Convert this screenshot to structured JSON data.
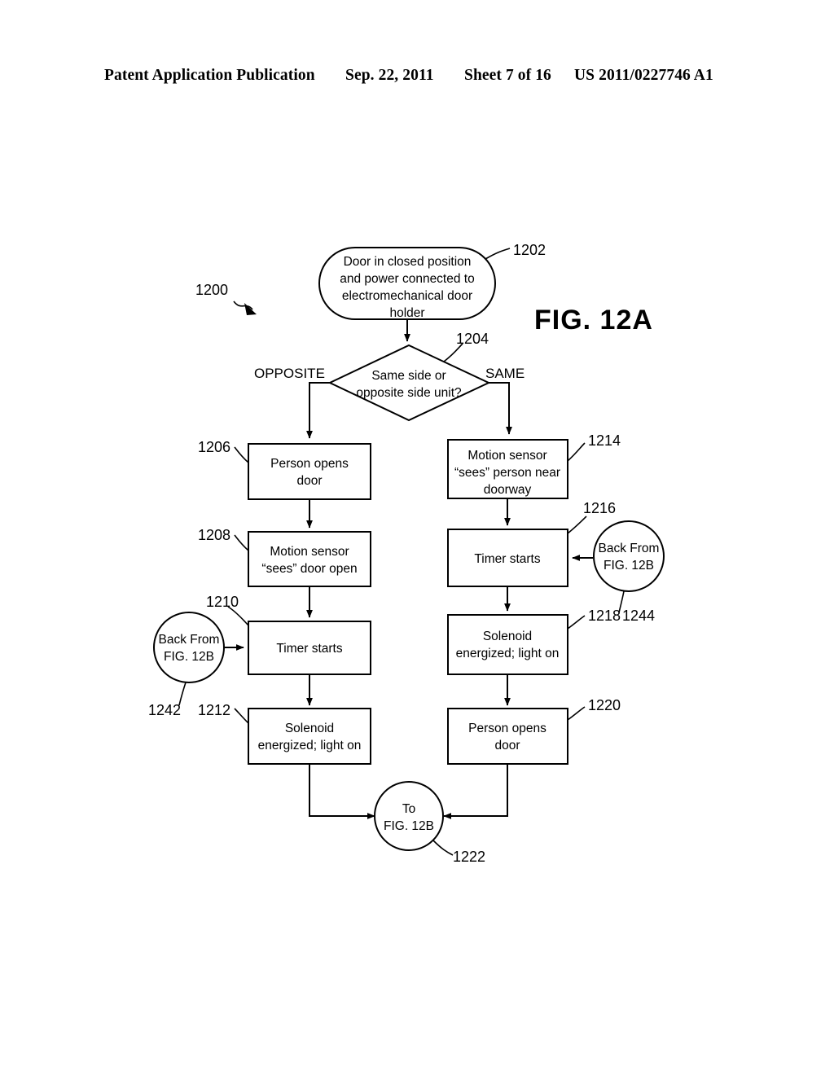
{
  "header": {
    "publication": "Patent Application Publication",
    "date": "Sep. 22, 2011",
    "sheet": "Sheet 7 of 16",
    "patent_number": "US 2011/0227746 A1"
  },
  "figure": {
    "title": "FIG. 12A",
    "diagram_ref": "1200"
  },
  "chart_data": {
    "type": "diagram",
    "title": "FIG. 12A",
    "diagram_ref": "1200",
    "nodes": [
      {
        "id": "1202",
        "shape": "terminal",
        "text": "Door in closed position and power connected to electromechanical door holder",
        "lines": [
          "Door in closed position",
          "and power connected to",
          "electromechanical door",
          "holder"
        ]
      },
      {
        "id": "1204",
        "shape": "decision",
        "text": "Same side or opposite side unit?",
        "lines": [
          "Same side or",
          "opposite side unit?"
        ]
      },
      {
        "id": "1206",
        "shape": "process",
        "text": "Person opens door",
        "lines": [
          "Person opens",
          "door"
        ]
      },
      {
        "id": "1208",
        "shape": "process",
        "text": "Motion sensor “sees” door open",
        "lines": [
          "Motion sensor",
          "“sees” door open"
        ]
      },
      {
        "id": "1210",
        "shape": "process",
        "text": "Timer starts",
        "lines": [
          "Timer starts"
        ]
      },
      {
        "id": "1212",
        "shape": "process",
        "text": "Solenoid energized; light on",
        "lines": [
          "Solenoid",
          "energized; light on"
        ]
      },
      {
        "id": "1214",
        "shape": "process",
        "text": "Motion sensor “sees” person near doorway",
        "lines": [
          "Motion sensor",
          "“sees” person near",
          "doorway"
        ]
      },
      {
        "id": "1216",
        "shape": "process",
        "text": "Timer starts",
        "lines": [
          "Timer starts"
        ]
      },
      {
        "id": "1218",
        "shape": "process",
        "text": "Solenoid energized; light on",
        "lines": [
          "Solenoid",
          "energized; light on"
        ]
      },
      {
        "id": "1220",
        "shape": "process",
        "text": "Person opens door",
        "lines": [
          "Person opens",
          "door"
        ]
      },
      {
        "id": "1222",
        "shape": "connector",
        "text": "To FIG. 12B",
        "lines": [
          "To",
          "FIG. 12B"
        ]
      },
      {
        "id": "1242",
        "shape": "connector",
        "text": "Back From FIG. 12B",
        "lines": [
          "Back From",
          "FIG. 12B"
        ]
      },
      {
        "id": "1244",
        "shape": "connector",
        "text": "Back From FIG. 12B",
        "lines": [
          "Back From",
          "FIG. 12B"
        ]
      }
    ],
    "branch_labels": [
      {
        "id": "opposite",
        "text": "OPPOSITE"
      },
      {
        "id": "same",
        "text": "SAME"
      }
    ],
    "edges": [
      {
        "from": "1202",
        "to": "1204"
      },
      {
        "from": "1204",
        "to": "1206",
        "label": "OPPOSITE"
      },
      {
        "from": "1204",
        "to": "1214",
        "label": "SAME"
      },
      {
        "from": "1206",
        "to": "1208"
      },
      {
        "from": "1208",
        "to": "1210"
      },
      {
        "from": "1242",
        "to": "1210"
      },
      {
        "from": "1210",
        "to": "1212"
      },
      {
        "from": "1212",
        "to": "1222"
      },
      {
        "from": "1214",
        "to": "1216"
      },
      {
        "from": "1244",
        "to": "1216"
      },
      {
        "from": "1216",
        "to": "1218"
      },
      {
        "from": "1218",
        "to": "1220"
      },
      {
        "from": "1220",
        "to": "1222"
      }
    ]
  }
}
